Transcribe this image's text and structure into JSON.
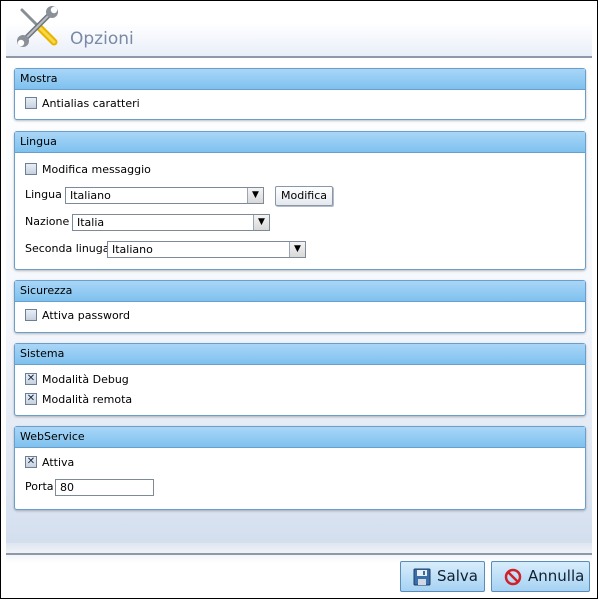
{
  "header": {
    "title": "Opzioni"
  },
  "groups": {
    "mostra": {
      "title": "Mostra",
      "antialias": {
        "label": "Antialias caratteri",
        "checked": false
      }
    },
    "lingua": {
      "title": "Lingua",
      "modifica_messaggio": {
        "label": "Modifica messaggio",
        "checked": false
      },
      "lingua_label": "Lingua",
      "lingua_value": "Italiano",
      "modifica_button": "Modifica",
      "nazione_label": "Nazione",
      "nazione_value": "Italia",
      "seconda_label": "Seconda linuga",
      "seconda_value": "Italiano"
    },
    "sicurezza": {
      "title": "Sicurezza",
      "attiva_password": {
        "label": "Attiva password",
        "checked": false
      }
    },
    "sistema": {
      "title": "Sistema",
      "debug": {
        "label": "Modalità Debug",
        "checked": true
      },
      "remota": {
        "label": "Modalità remota",
        "checked": true
      }
    },
    "webservice": {
      "title": "WebService",
      "attiva": {
        "label": "Attiva",
        "checked": true
      },
      "porta_label": "Porta",
      "porta_value": "80"
    }
  },
  "footer": {
    "save_label": "Salva",
    "cancel_label": "Annulla"
  },
  "colors": {
    "group_header": "#7ec1ef",
    "border": "#6a9fcc",
    "title": "#7a8aa6",
    "cancel_icon": "#d0202a"
  },
  "icons": {
    "logo": "wrench-screwdriver-icon",
    "save": "floppy-disk-icon",
    "cancel": "no-entry-icon"
  }
}
